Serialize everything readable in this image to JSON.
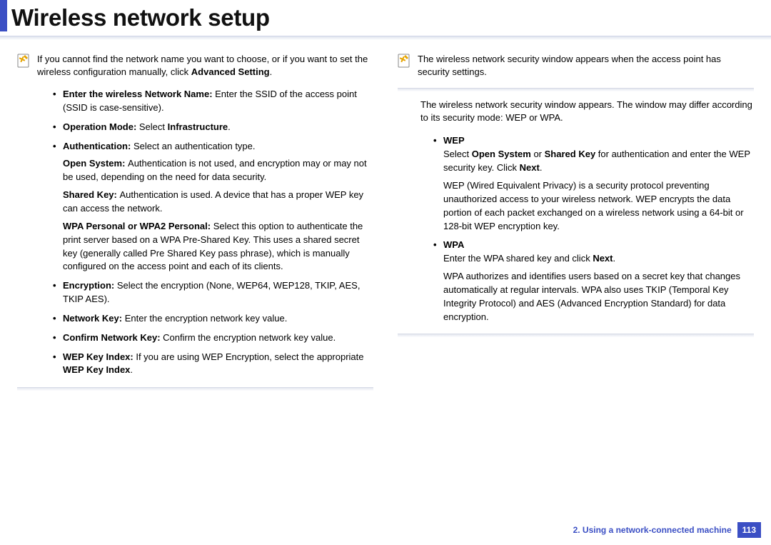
{
  "header": {
    "title": "Wireless network setup"
  },
  "left": {
    "note": "If you cannot find the network name you want to choose, or if you want to set the wireless configuration manually, click ",
    "note_bold": "Advanced Setting",
    "note_tail": ".",
    "items": {
      "ssid_label": "Enter the wireless Network Name: ",
      "ssid_text": "Enter the SSID of the access point (SSID is case-sensitive).",
      "op_label": "Operation Mode: ",
      "op_text1": "Select ",
      "op_bold": "Infrastructure",
      "op_tail": ".",
      "auth_label": "Authentication: ",
      "auth_text": "Select an authentication type.",
      "open_label": "Open System: ",
      "open_text": "Authentication is not used, and encryption may or may not be used, depending on the need for data security.",
      "shared_label": "Shared Key: ",
      "shared_text": "Authentication is used. A device that has a proper WEP key can access the network.",
      "wpa_label": "WPA Personal or WPA2 Personal: ",
      "wpa_text": "Select this option to authenticate the print server based on a WPA Pre-Shared Key. This uses a shared secret key (generally called Pre Shared Key pass phrase), which is manually configured on the access point and each of its clients.",
      "enc_label": "Encryption: ",
      "enc_text": "Select the encryption (None, WEP64, WEP128, TKIP, AES, TKIP AES).",
      "nk_label": "Network Key: ",
      "nk_text": "Enter the encryption network key value.",
      "cnk_label": "Confirm Network Key: ",
      "cnk_text": "Confirm the encryption network key value.",
      "wki_label": "WEP Key Index: ",
      "wki_text": "If you are using WEP Encryption, select the appropriate ",
      "wki_bold": "WEP Key Index",
      "wki_tail": "."
    }
  },
  "right": {
    "note": "The wireless network security window appears when the access point has security settings.",
    "body": "The wireless network security window appears. The window may differ according to its security mode: WEP or WPA.",
    "wep_title": "WEP",
    "wep_line1a": "Select ",
    "wep_line1b": "Open System",
    "wep_line1c": " or ",
    "wep_line1d": "Shared Key",
    "wep_line1e": " for authentication and enter the WEP security key. Click ",
    "wep_line1f": "Next",
    "wep_line1g": ".",
    "wep_desc": "WEP (Wired Equivalent Privacy) is a security protocol preventing unauthorized access to your wireless network. WEP encrypts the data portion of each packet exchanged on a wireless network using a 64-bit or 128-bit WEP encryption key.",
    "wpa_title": "WPA",
    "wpa_line1a": "Enter the WPA shared key and click ",
    "wpa_line1b": "Next",
    "wpa_line1c": ".",
    "wpa_desc": "WPA authorizes and identifies users based on a secret key that changes automatically at regular intervals. WPA also uses TKIP (Temporal Key Integrity Protocol) and AES (Advanced Encryption Standard) for data encryption."
  },
  "footer": {
    "chapter": "2.  Using a network-connected machine",
    "page": "113"
  }
}
